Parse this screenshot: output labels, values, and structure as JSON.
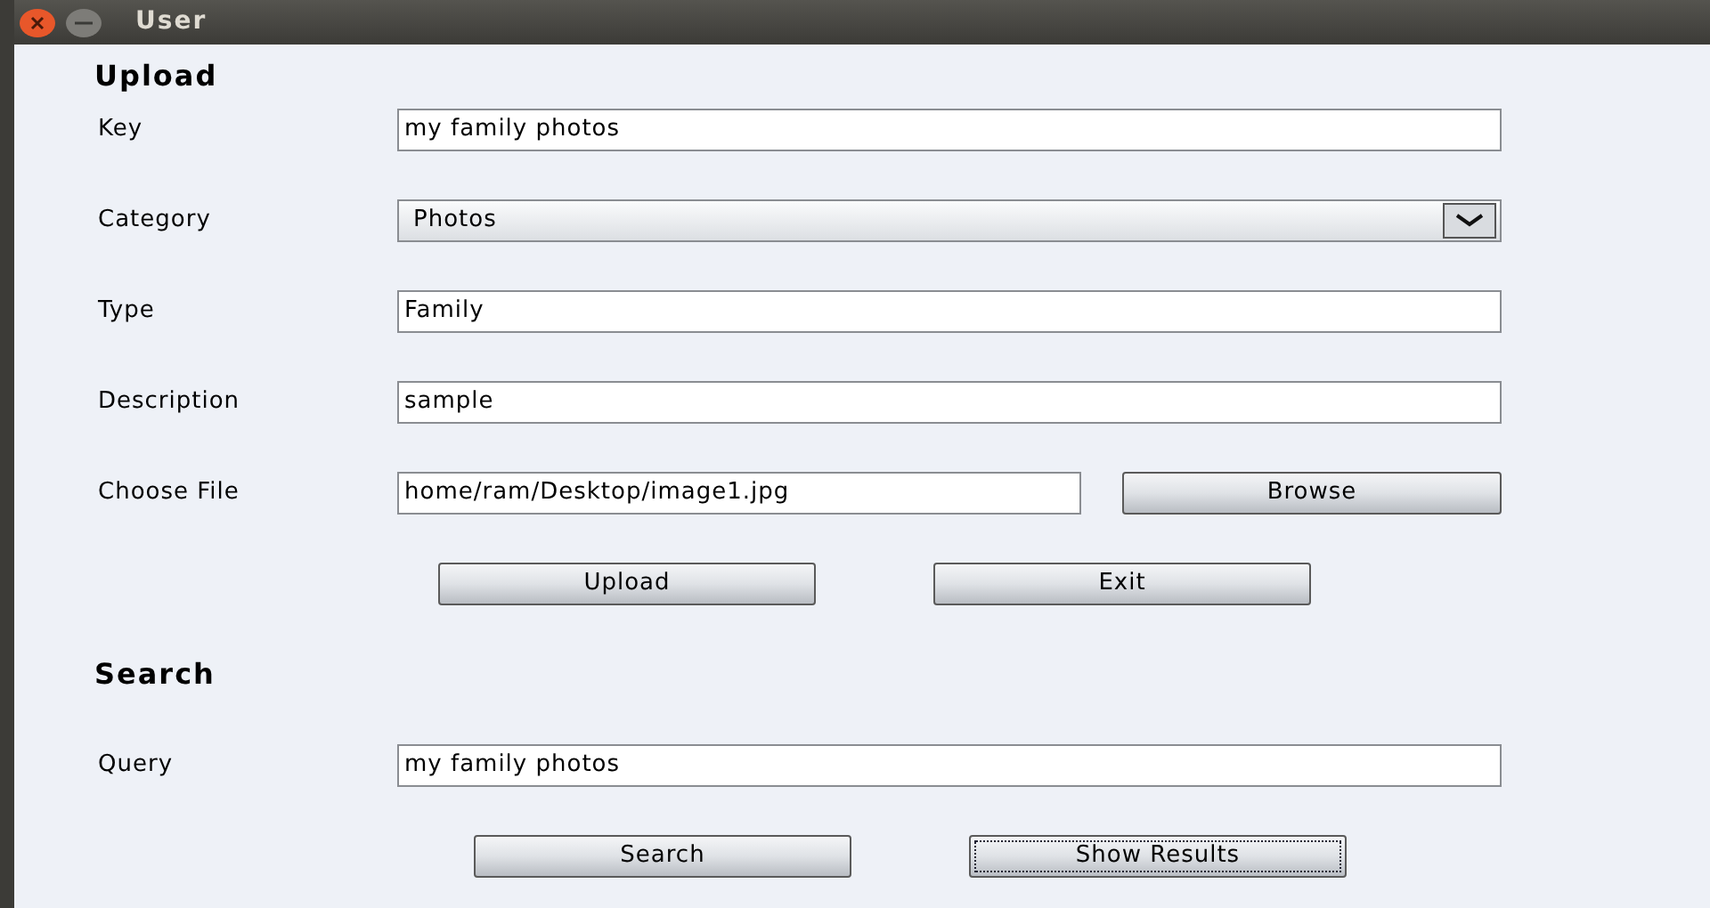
{
  "window": {
    "title": "User"
  },
  "upload": {
    "heading": "Upload",
    "fields": [
      {
        "kind": "text",
        "label": "Key",
        "value": "my family photos"
      },
      {
        "kind": "select",
        "label": "Category",
        "value": "Photos"
      },
      {
        "kind": "text",
        "label": "Type",
        "value": "Family"
      },
      {
        "kind": "text",
        "label": "Description",
        "value": "sample"
      },
      {
        "kind": "file",
        "label": "Choose File",
        "value": "home/ram/Desktop/image1.jpg",
        "button": "Browse"
      }
    ],
    "buttons": [
      {
        "label": "Upload",
        "focused": false
      },
      {
        "label": "Exit",
        "focused": false
      }
    ]
  },
  "search": {
    "heading": "Search",
    "fields": [
      {
        "kind": "text",
        "label": "Query",
        "value": "my family photos"
      }
    ],
    "buttons": [
      {
        "label": "Search",
        "focused": false
      },
      {
        "label": "Show Results",
        "focused": true
      }
    ]
  }
}
